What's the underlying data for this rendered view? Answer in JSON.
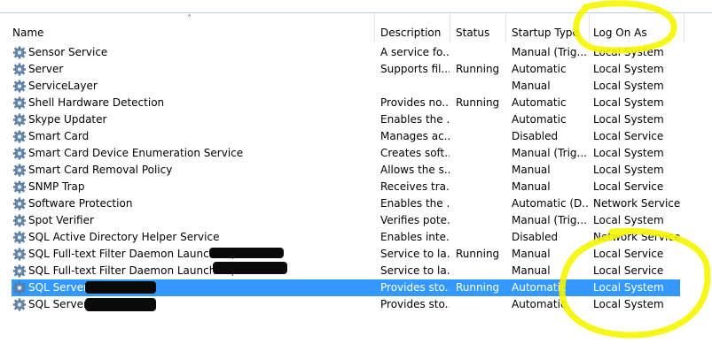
{
  "columns": {
    "name": "Name",
    "description": "Description",
    "status": "Status",
    "startup_type": "Startup Type",
    "log_on_as": "Log On As"
  },
  "services": [
    {
      "name": "Sensor Service",
      "description": "A service fo...",
      "status": "",
      "startup_type": "Manual (Trig...",
      "log_on_as": "Local System"
    },
    {
      "name": "Server",
      "description": "Supports fil...",
      "status": "Running",
      "startup_type": "Automatic",
      "log_on_as": "Local System"
    },
    {
      "name": "ServiceLayer",
      "description": "",
      "status": "",
      "startup_type": "Manual",
      "log_on_as": "Local System"
    },
    {
      "name": "Shell Hardware Detection",
      "description": "Provides no...",
      "status": "Running",
      "startup_type": "Automatic",
      "log_on_as": "Local System"
    },
    {
      "name": "Skype Updater",
      "description": "Enables the ...",
      "status": "",
      "startup_type": "Automatic",
      "log_on_as": "Local System"
    },
    {
      "name": "Smart Card",
      "description": "Manages ac...",
      "status": "",
      "startup_type": "Disabled",
      "log_on_as": "Local Service"
    },
    {
      "name": "Smart Card Device Enumeration Service",
      "description": "Creates soft...",
      "status": "",
      "startup_type": "Manual (Trig...",
      "log_on_as": "Local System"
    },
    {
      "name": "Smart Card Removal Policy",
      "description": "Allows the s...",
      "status": "",
      "startup_type": "Manual",
      "log_on_as": "Local System"
    },
    {
      "name": "SNMP Trap",
      "description": "Receives tra...",
      "status": "",
      "startup_type": "Manual",
      "log_on_as": "Local Service"
    },
    {
      "name": "Software Protection",
      "description": "Enables the ...",
      "status": "",
      "startup_type": "Automatic (D...",
      "log_on_as": "Network Service"
    },
    {
      "name": "Spot Verifier",
      "description": "Verifies pote...",
      "status": "",
      "startup_type": "Manual (Trig...",
      "log_on_as": "Local System"
    },
    {
      "name": "SQL Active Directory Helper Service",
      "description": "Enables inte...",
      "status": "",
      "startup_type": "Disabled",
      "log_on_as": "Network Service"
    },
    {
      "name": "SQL Full-text Filter Daemon Launcher (",
      "description": "Service to la...",
      "status": "Running",
      "startup_type": "Manual",
      "log_on_as": "Local Service"
    },
    {
      "name": "SQL Full-text Filter Daemon Launcher (",
      "description": "Service to la...",
      "status": "",
      "startup_type": "Manual",
      "log_on_as": "Local Service"
    },
    {
      "name": "SQL Server (",
      "description": "Provides sto...",
      "status": "Running",
      "startup_type": "Automatic",
      "log_on_as": "Local System",
      "selected": true
    },
    {
      "name": "SQL Server (",
      "description": "Provides sto...",
      "status": "",
      "startup_type": "Automatic",
      "log_on_as": "Local System"
    }
  ],
  "colors": {
    "selection": "#3399ff",
    "highlight_marker": "#f5f500",
    "redaction": "#0a0a0a"
  },
  "icons": {
    "service_icon": "gear-icon",
    "sort_indicator": "chevron-up-icon"
  }
}
